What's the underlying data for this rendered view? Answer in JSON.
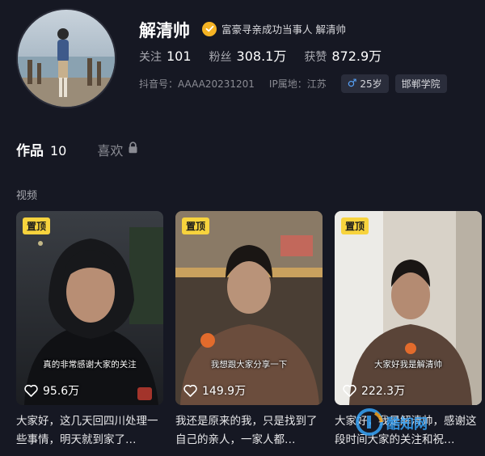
{
  "profile": {
    "name": "解清帅",
    "verify_text": "富豪寻亲成功当事人 解清帅",
    "stats": [
      {
        "label": "关注",
        "value": "101"
      },
      {
        "label": "粉丝",
        "value": "308.1万"
      },
      {
        "label": "获赞",
        "value": "872.9万"
      }
    ],
    "douyin_id": "抖音号：AAAA20231201",
    "ip_location": "IP属地：江苏",
    "gender_age": "25岁",
    "school": "邯郸学院"
  },
  "tabs": {
    "works_label": "作品",
    "works_count": "10",
    "likes_label": "喜欢"
  },
  "section_label": "视频",
  "videos": [
    {
      "pin": "置顶",
      "caption": "真的非常感谢大家的关注",
      "likes": "95.6万",
      "description": "大家好，这几天回四川处理一些事情，明天就到家了…"
    },
    {
      "pin": "置顶",
      "caption": "我想跟大家分享一下",
      "likes": "149.9万",
      "description": "我还是原来的我，只是找到了自己的亲人，一家人都…"
    },
    {
      "pin": "置顶",
      "caption": "大家好我是解清帅",
      "likes": "222.3万",
      "description": "大家好，我是解清帅，感谢这段时间大家的关注和祝…"
    }
  ],
  "watermark": "酷知网",
  "icons": {
    "verify": "verified-badge-icon",
    "gender": "male-icon",
    "lock": "lock-icon",
    "heart": "heart-icon"
  },
  "colors": {
    "background": "#161823",
    "verify": "#f5b324",
    "pin": "#f7d33d",
    "male": "#58a6ff"
  }
}
